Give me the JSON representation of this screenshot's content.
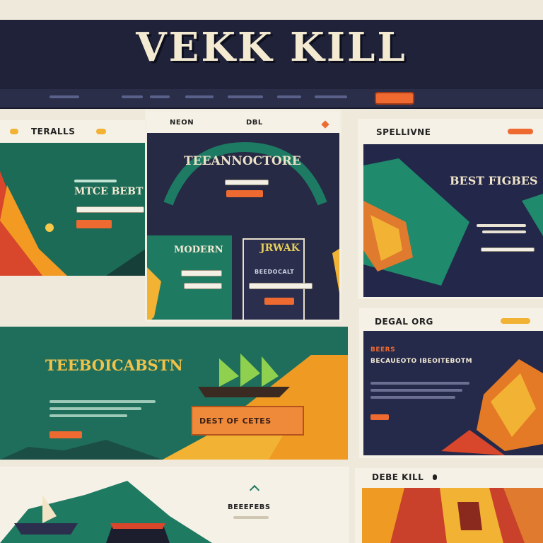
{
  "header": {
    "logo": "VEKK KILL",
    "nav_items": [
      "",
      "",
      "",
      "",
      "",
      "",
      ""
    ],
    "cta_label": ""
  },
  "left_panel": {
    "tab_label": "TERALLS",
    "headline": "MTCE BEBT"
  },
  "center_window": {
    "tab_left": "NEON",
    "tab_right": "DBL",
    "title": "TEEANNOCTORE",
    "card_a_title": "MODERN",
    "card_b_title": "JRWAK",
    "card_b_subtitle": "BEEDOCALT"
  },
  "right_top": {
    "tab_label": "SPELLIVNE",
    "title": "BEST FIGBES"
  },
  "banner": {
    "title": "TEEBOICABSTN",
    "cta_label": "DEST OF CETES"
  },
  "right_mid": {
    "tab_label": "DEGAL ORG",
    "headline_a": "BEERS",
    "headline_b": "BECAUEOTO IBEOITEBOTM"
  },
  "bottom_center": {
    "caption": "BEEEFEBS"
  },
  "bottom_right": {
    "tab_label": "DEBE KILL"
  },
  "colors": {
    "navy": "#1f2238",
    "teal": "#1f7a62",
    "orange": "#ee6a30",
    "cream": "#efe9dc",
    "gold": "#f2b233"
  }
}
